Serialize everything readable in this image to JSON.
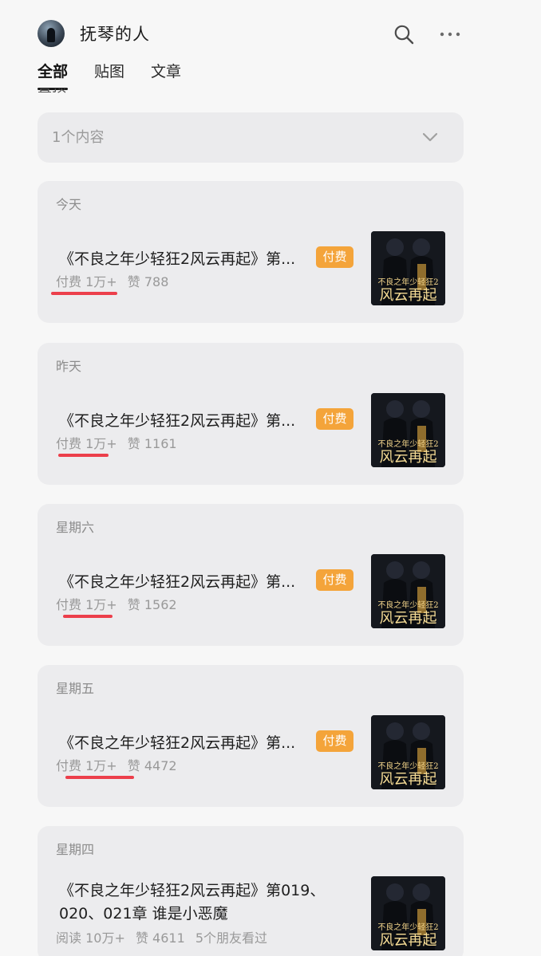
{
  "header": {
    "account_name": "抚琴的人"
  },
  "tabs": [
    {
      "label": "全部",
      "active": true
    },
    {
      "label": "贴图",
      "active": false
    },
    {
      "label": "文章",
      "active": false
    }
  ],
  "clipped_text": "置顶",
  "filter": {
    "label": "1个内容"
  },
  "thumbnail_text": {
    "line1": "不良之年少轻狂2",
    "line2": "风云再起"
  },
  "posts": [
    {
      "date": "今天",
      "title": "《不良之年少轻狂2风云再起》第...",
      "tag": "付费",
      "meta": [
        "付费 1万+",
        "赞 788"
      ]
    },
    {
      "date": "昨天",
      "title": "《不良之年少轻狂2风云再起》第...",
      "tag": "付费",
      "meta": [
        "付费 1万+",
        "赞 1161"
      ]
    },
    {
      "date": "星期六",
      "title": "《不良之年少轻狂2风云再起》第...",
      "tag": "付费",
      "meta": [
        "付费 1万+",
        "赞 1562"
      ]
    },
    {
      "date": "星期五",
      "title": "《不良之年少轻狂2风云再起》第...",
      "tag": "付费",
      "meta": [
        "付费 1万+",
        "赞 4472"
      ]
    },
    {
      "date": "星期四",
      "title": "《不良之年少轻狂2风云再起》第019、020、021章 谁是小恶魔",
      "meta": [
        "阅读 10万+",
        "赞 4611",
        "5个朋友看过"
      ]
    }
  ],
  "colors": {
    "background": "#f7f7f7",
    "card": "#ececee",
    "paid_tag": "#f4a43a",
    "underline": "#ec3f4b",
    "meta_text": "#999999"
  },
  "icons": {
    "search": "search-icon",
    "more": "more-icon",
    "filter": "chevron-down-icon"
  }
}
